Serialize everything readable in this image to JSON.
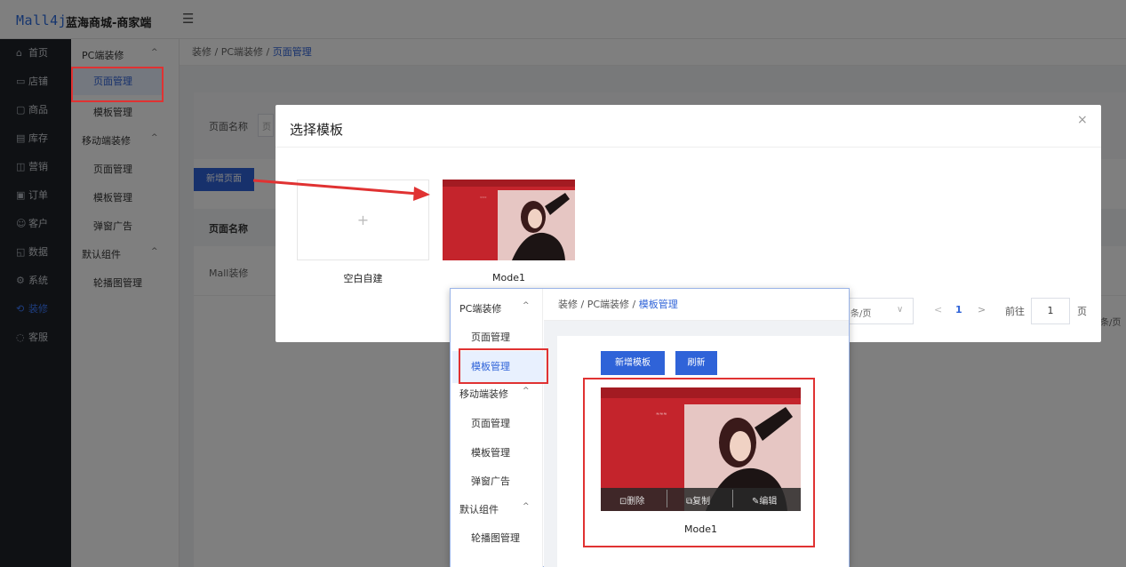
{
  "header": {
    "logo": "Mall4j",
    "brand": "蓝海商城-商家端",
    "fold_icon": "☰"
  },
  "left_nav": [
    {
      "icon": "⌂",
      "label": "首页"
    },
    {
      "icon": "▭",
      "label": "店铺"
    },
    {
      "icon": "▢",
      "label": "商品"
    },
    {
      "icon": "▤",
      "label": "库存"
    },
    {
      "icon": "◫",
      "label": "营销"
    },
    {
      "icon": "▣",
      "label": "订单"
    },
    {
      "icon": "☺",
      "label": "客户"
    },
    {
      "icon": "◱",
      "label": "数据"
    },
    {
      "icon": "⚙",
      "label": "系统"
    },
    {
      "icon": "⟲",
      "label": "装修"
    },
    {
      "icon": "◌",
      "label": "客服"
    }
  ],
  "sub_menu": {
    "group1": "PC端装修",
    "group1_items": [
      "页面管理",
      "模板管理"
    ],
    "group2": "移动端装修",
    "group2_items": [
      "页面管理",
      "模板管理",
      "弹窗广告"
    ],
    "group3": "默认组件",
    "group3_items": [
      "轮播图管理"
    ],
    "caret": "^"
  },
  "breadcrumb": {
    "part1": "装修",
    "sep": "/",
    "part2": "PC端装修",
    "current": "页面管理"
  },
  "search": {
    "label": "页面名称",
    "placeholder": "页"
  },
  "toolbar": {
    "add_page": "新增页面"
  },
  "table": {
    "header": "页面名称",
    "row1": "Mall装修"
  },
  "pagination": {
    "per_page": "条/页",
    "per_page_partial": "条/页",
    "current": "1",
    "goto": "前往",
    "goto_value": "1",
    "page": "页",
    "prev": "<",
    "next": ">",
    "dropdown": "∨"
  },
  "modal": {
    "title": "选择模板",
    "close": "×",
    "blank_plus": "+",
    "blank_label": "空白自建",
    "template_label": "Mode1"
  },
  "inset": {
    "breadcrumb": {
      "part1": "装修",
      "part2": "PC端装修",
      "current": "模板管理"
    },
    "menu": {
      "group1": "PC端装修",
      "items1": [
        "页面管理",
        "模板管理"
      ],
      "group2": "移动端装修",
      "items2": [
        "页面管理",
        "模板管理",
        "弹窗广告"
      ],
      "group3": "默认组件",
      "items3": [
        "轮播图管理"
      ]
    },
    "add_template": "新增模板",
    "refresh": "刷新",
    "actions": {
      "delete": "删除",
      "copy": "复制",
      "edit": "编辑"
    },
    "template_label": "Mode1"
  },
  "colors": {
    "primary": "#2f63d8",
    "highlight": "#e03232",
    "nav_bg": "#1f2329"
  }
}
